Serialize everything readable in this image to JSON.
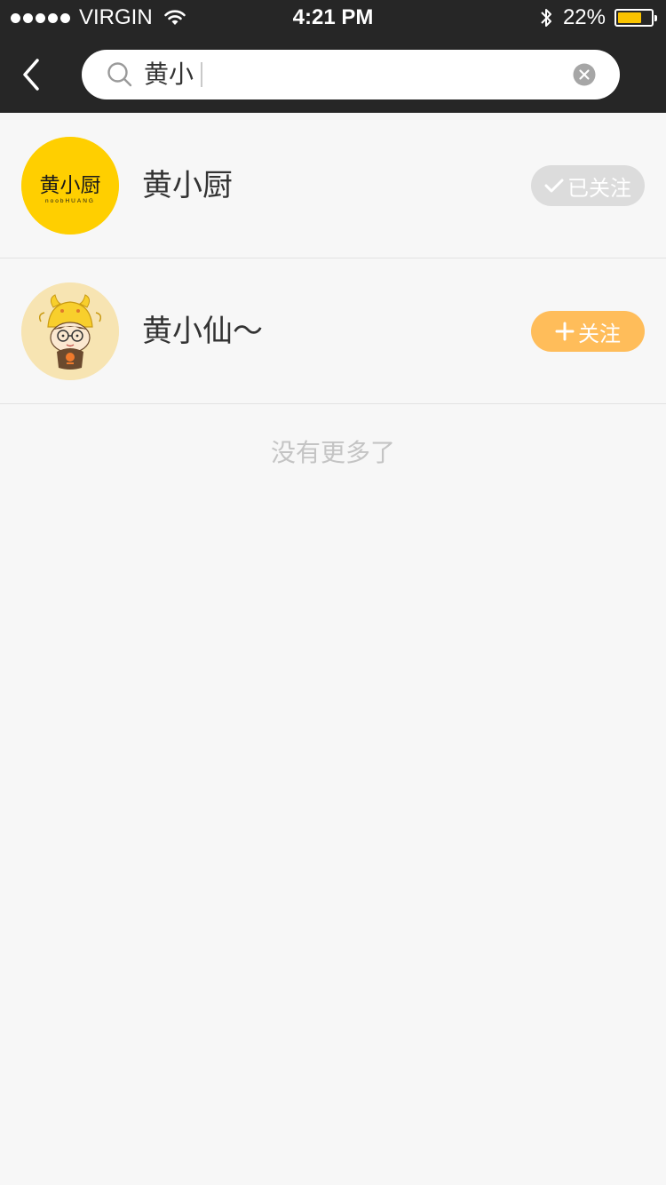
{
  "status_bar": {
    "carrier": "VIRGIN",
    "time": "4:21 PM",
    "battery": "22%",
    "battery_level": 0.22
  },
  "search": {
    "value": "黄小",
    "placeholder": ""
  },
  "results": [
    {
      "name": "黄小厨",
      "avatar_text": "黄小厨",
      "avatar_subtext": "noobHUANG",
      "button_label": "已关注",
      "followed": true
    },
    {
      "name": "黄小仙～",
      "button_label": "关注",
      "followed": false
    }
  ],
  "footer": {
    "no_more": "没有更多了"
  },
  "colors": {
    "header_bg": "#262626",
    "accent_yellow": "#f9c300",
    "follow_orange": "#ffbd5a",
    "followed_gray": "#dcdcdc"
  }
}
